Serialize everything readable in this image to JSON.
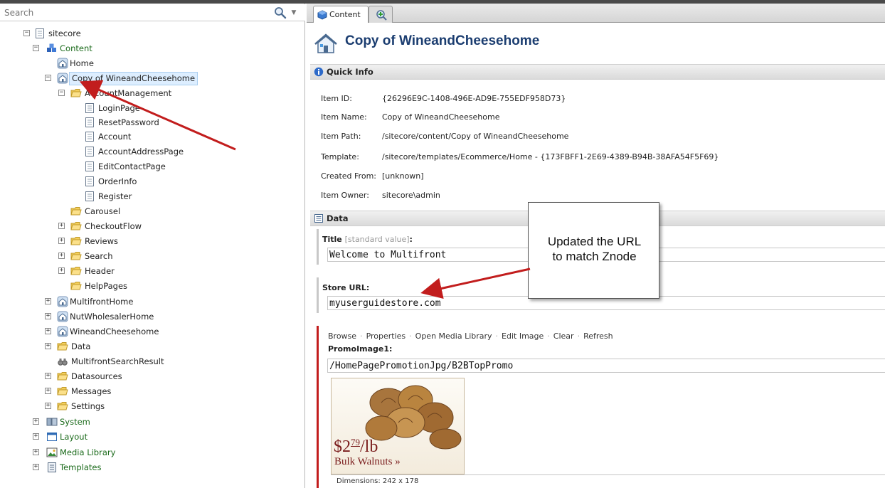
{
  "search": {
    "placeholder": "Search"
  },
  "tree": {
    "root": "sitecore",
    "content": "Content",
    "home": "Home",
    "copy": "Copy of WineandCheesehome",
    "account_management": "AccountManagement",
    "pages": [
      "LoginPage",
      "ResetPassword",
      "Account",
      "AccountAddressPage",
      "EditContactPage",
      "OrderInfo",
      "Register"
    ],
    "folders": [
      "Carousel",
      "CheckoutFlow",
      "Reviews",
      "Search",
      "Header",
      "HelpPages"
    ],
    "sites": [
      "MultifrontHome",
      "NutWholesalerHome",
      "WineandCheesehome"
    ],
    "data": "Data",
    "search_result": "MultifrontSearchResult",
    "other_folders": [
      "Datasources",
      "Messages",
      "Settings"
    ],
    "system": "System",
    "layout": "Layout",
    "media_library": "Media Library",
    "templates": "Templates"
  },
  "tabs": {
    "content": "Content"
  },
  "item": {
    "title": "Copy of WineandCheesehome",
    "quick_info_label": "Quick Info",
    "rows": [
      {
        "k": "Item ID:",
        "v": "{26296E9C-1408-496E-AD9E-755EDF958D73}"
      },
      {
        "k": "Item Name:",
        "v": "Copy of WineandCheesehome"
      },
      {
        "k": "Item Path:",
        "v": "/sitecore/content/Copy of WineandCheesehome"
      },
      {
        "k": "Template:",
        "v": "/sitecore/templates/Ecommerce/Home - {173FBFF1-2E69-4389-B94B-38AFA54F5F69}"
      },
      {
        "k": "Created From:",
        "v": "[unknown]"
      },
      {
        "k": "Item Owner:",
        "v": "sitecore\\admin"
      }
    ]
  },
  "data_section": {
    "label": "Data",
    "title_label": "Title",
    "title_std": "[standard value]",
    "title_colon": ":",
    "title_value": "Welcome to Multifront",
    "store_url_label": "Store URL:",
    "store_url_value": "myuserguidestore.com",
    "promo_actions": [
      "Browse",
      "Properties",
      "Open Media Library",
      "Edit Image",
      "Clear",
      "Refresh"
    ],
    "promo_label": "PromoImage1:",
    "promo_path": "/HomePagePromotionJpg/B2BTopPromo",
    "promo_price_dollars": "$2",
    "promo_price_cents": "79",
    "promo_price_unit": "/lb",
    "promo_name": "Bulk Walnuts »",
    "dimensions": "Dimensions: 242 x 178"
  },
  "callout": {
    "line1": "Updated the URL",
    "line2": "to match Znode"
  },
  "colors": {
    "annotation_red": "#c21d1d",
    "title_blue": "#1b3d70",
    "tree_green": "#1a6a1a"
  }
}
